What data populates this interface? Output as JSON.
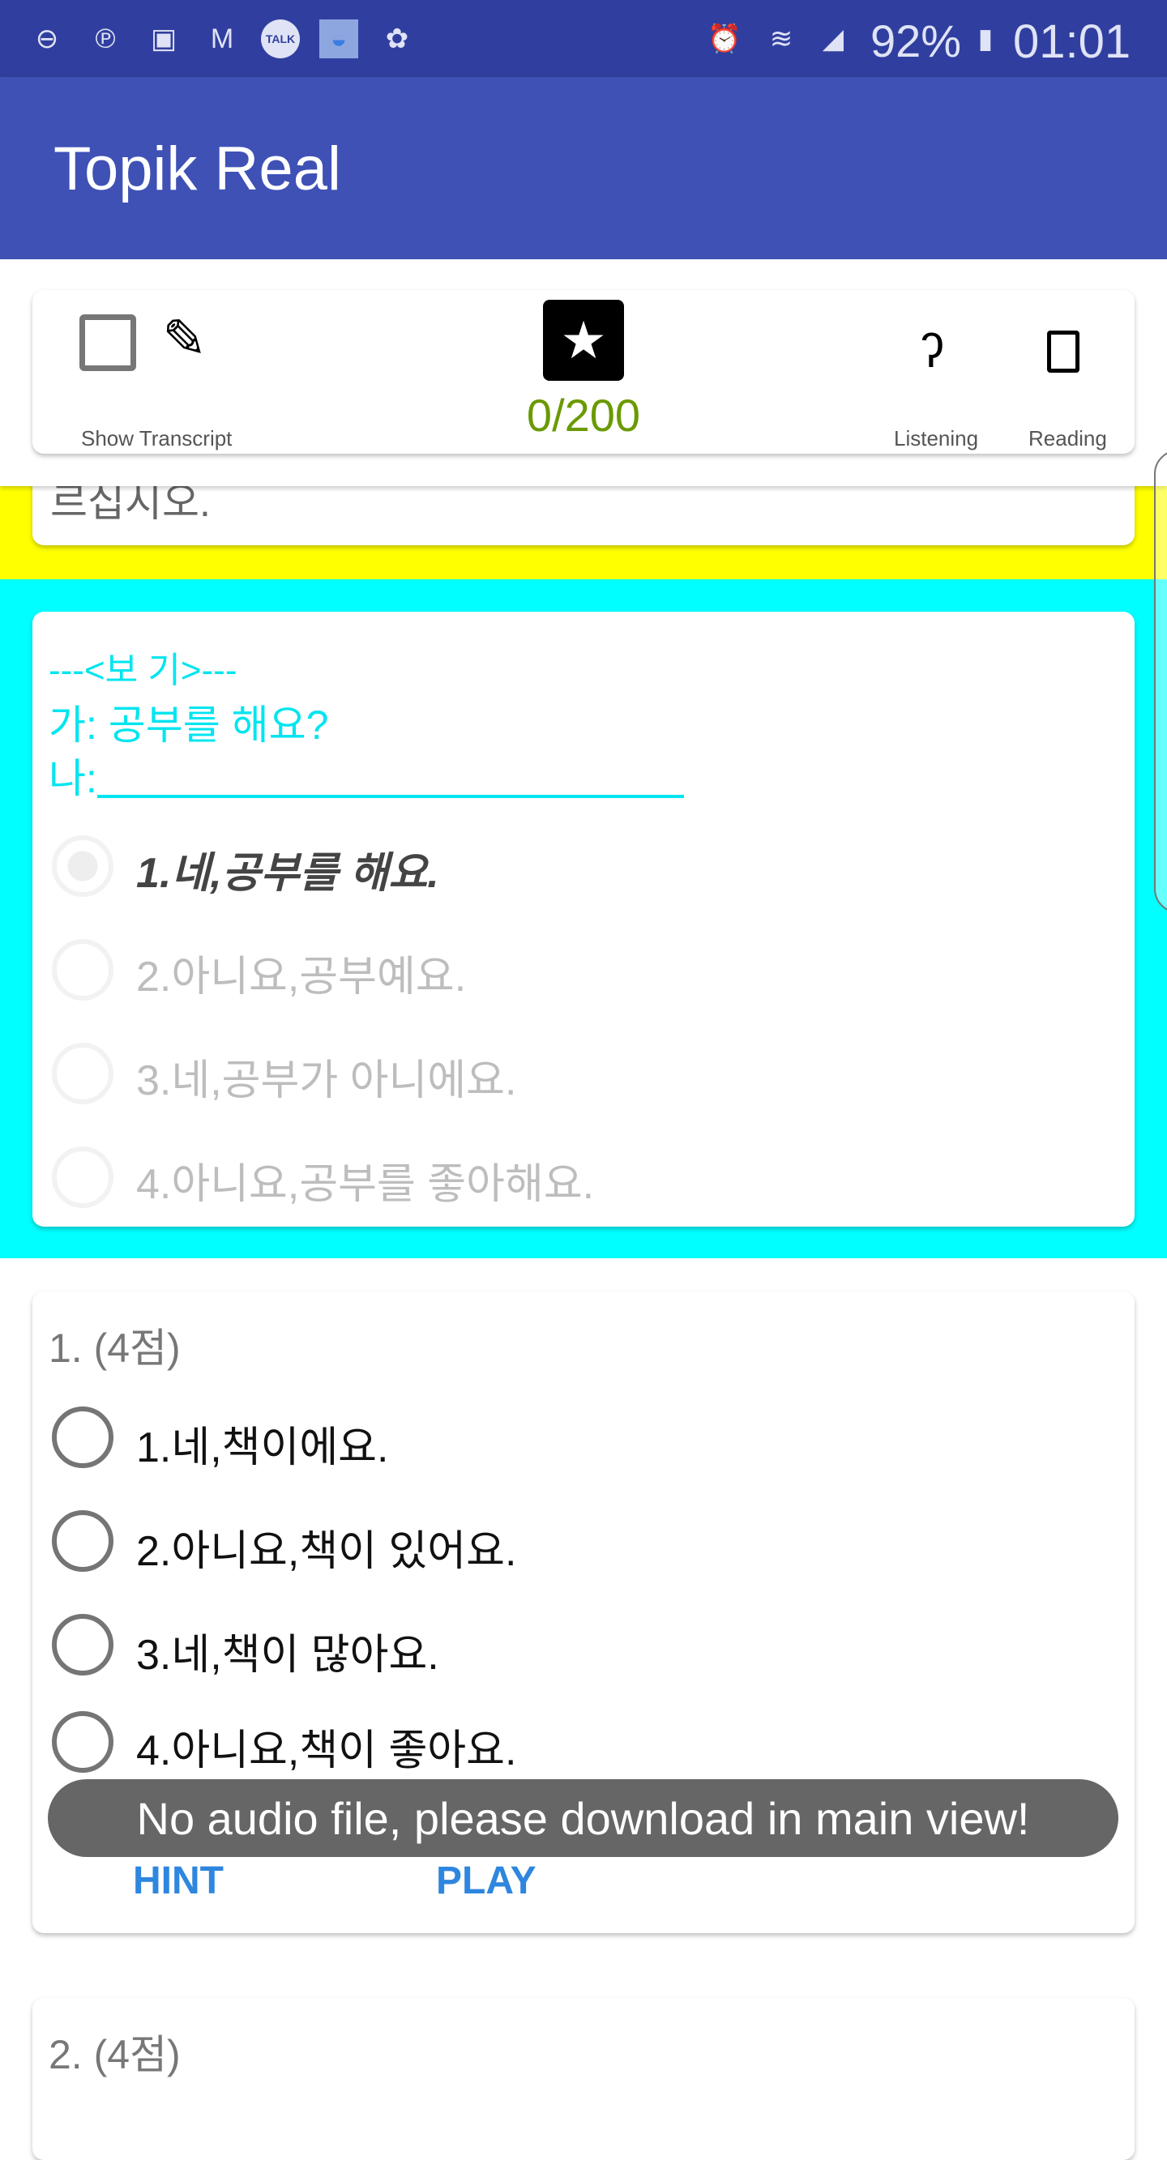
{
  "status_bar": {
    "left_icons": [
      "dnd-icon",
      "pinterest-icon",
      "gallery-icon",
      "gmail-icon",
      "kakaotalk-icon",
      "wifi-hotspot-icon",
      "settings-gear-icon"
    ],
    "talk_label": "TALK",
    "battery": "92%",
    "time": "01:01"
  },
  "app_bar": {
    "title": "Topik Real"
  },
  "toolbar": {
    "show_transcript": "Show Transcript",
    "score": "0/200",
    "listening": "Listening",
    "reading": "Reading",
    "score_color": "#6a9a00"
  },
  "prev_card": {
    "text_tail": "르십시오."
  },
  "example_card": {
    "header": "---<보 기>---",
    "line1": "가: 공부를 해요?",
    "line2": "나:",
    "accent": "#00ffff",
    "options": [
      "1.네,공부를 해요.",
      "2.아니요,공부예요.",
      "3.네,공부가 아니에요.",
      "4.아니요,공부를 좋아해요."
    ],
    "selected": 0
  },
  "question1": {
    "title": "1.  (4점)",
    "options": [
      "1.네,책이에요.",
      "2.아니요,책이 있어요.",
      "3.네,책이 많아요.",
      "4.아니요,책이 좋아요."
    ],
    "hint": "HINT",
    "play": "PLAY"
  },
  "question2": {
    "title": "2.  (4점)"
  },
  "toast": {
    "message": "No audio file, please download in main view!"
  },
  "colors": {
    "status_bar": "#303f9f",
    "app_bar": "#3f51b5",
    "yellow": "#ffff00",
    "cyan": "#00ffff",
    "button_text": "#2e86de"
  }
}
